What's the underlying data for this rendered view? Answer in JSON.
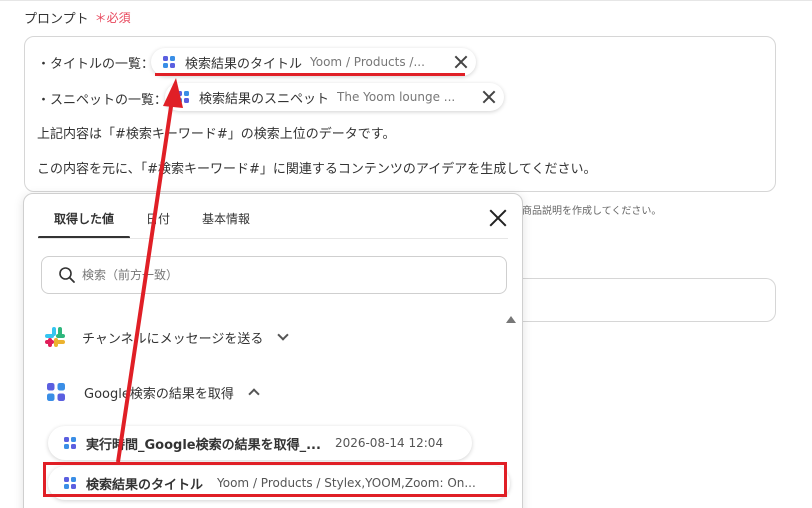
{
  "prompt": {
    "label": "プロンプト",
    "required": "＊必須",
    "line1": "・タイトルの一覧：",
    "line2": "・スニペットの一覧：",
    "line3": "上記内容は「#検索キーワード#」の検索上位のデータです。",
    "line4": "この内容を元に、「#検索キーワード#」に関連するコンテンツのアイデアを生成してください。",
    "chips": [
      {
        "title": "検索結果のタイトル",
        "sub": "Yoom / Products /..."
      },
      {
        "title": "検索結果のスニペット",
        "sub": "The Yoom lounge ..."
      }
    ]
  },
  "hint": "商品説明を作成してください。",
  "popup": {
    "tabs": [
      "取得した値",
      "日付",
      "基本情報"
    ],
    "search_placeholder": "検索（前方一致）",
    "groups": [
      {
        "label": "チャンネルにメッセージを送る"
      },
      {
        "label": "Google検索の結果を取得"
      }
    ],
    "items": [
      {
        "title": "実行時間_Google検索の結果を取得_...",
        "sub": "2026-08-14 12:04"
      },
      {
        "title": "検索結果のタイトル",
        "sub": "Yoom / Products / Stylex,YOOM,Zoom: On..."
      }
    ]
  },
  "colors": {
    "highlight": "#e01f26",
    "yoom_purple": "#5b5fe0",
    "yoom_blue": "#3a8ee6",
    "required": "#e8485d"
  }
}
